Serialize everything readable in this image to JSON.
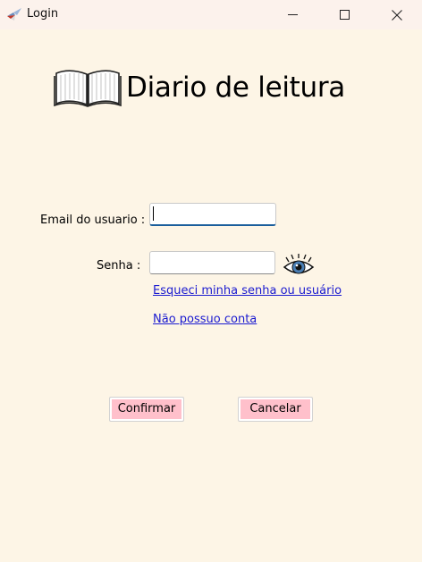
{
  "window": {
    "title": "Login"
  },
  "header": {
    "title": "Diario de leitura"
  },
  "form": {
    "email_label": "Email do usuario :",
    "email_value": "",
    "password_label": "Senha :",
    "password_value": "",
    "forgot_link": "Esqueci minha senha ou usuário",
    "no_account_link": "Não possuo conta"
  },
  "actions": {
    "confirm_label": "Confirmar",
    "cancel_label": "Cancelar"
  },
  "colors": {
    "background": "#fdf5e6",
    "titlebar": "#fcf2ec",
    "button": "#ffc0cb",
    "link": "#1b1bd0",
    "input_focus": "#1a5e9c"
  },
  "icons": {
    "app": "feather-app-icon",
    "header": "open-book-icon",
    "password_toggle": "eye-icon"
  }
}
